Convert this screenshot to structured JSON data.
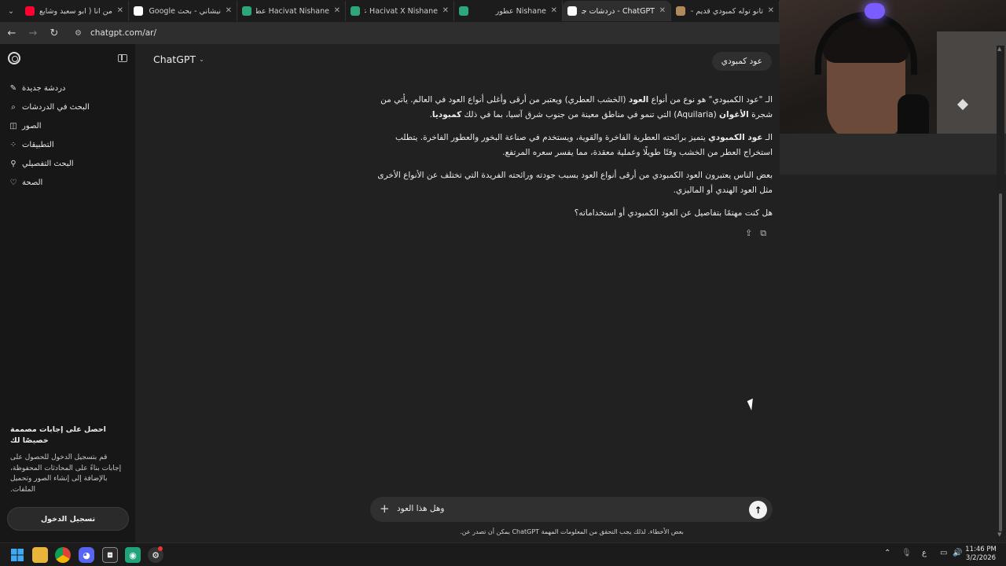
{
  "browser": {
    "tabs": [
      {
        "title": "من انا ( ابو سعيد وشايع ضـ",
        "favicon": "youtube-icon",
        "color": "#ff0033",
        "active": false
      },
      {
        "title": "نيشاني - بحث Google",
        "favicon": "google-icon",
        "color": "#ffffff",
        "active": false
      },
      {
        "title": "Hacivat Nishane عطر - a f",
        "favicon": "fragrantica-icon",
        "color": "#2fa67a",
        "active": false
      },
      {
        "title": "Hacivat X Nishane عطر - a",
        "favicon": "fragrantica-icon",
        "color": "#2fa67a",
        "active": false
      },
      {
        "title": "Nishane عطور",
        "favicon": "fragrantica-icon",
        "color": "#2fa67a",
        "active": false
      },
      {
        "title": "ChatGPT - دردشات جي بي تي",
        "favicon": "chatgpt-icon",
        "color": "#ffffff",
        "active": true
      },
      {
        "title": "تانو توله كمبودي قديم - ــ",
        "favicon": "site-icon",
        "color": "#b08a5a",
        "active": false
      }
    ],
    "tab_close_glyph": "✕",
    "url": "chatgpt.com/ar/"
  },
  "sidebar": {
    "items": [
      {
        "label": "دردشة جديدة",
        "icon": "edit-icon",
        "glyph": "✎"
      },
      {
        "label": "البحث في الدردشات",
        "icon": "search-icon",
        "glyph": "⌕"
      },
      {
        "label": "الصور",
        "icon": "image-icon",
        "glyph": "◫"
      },
      {
        "label": "التطبيقات",
        "icon": "apps-icon",
        "glyph": "⁘"
      },
      {
        "label": "البحث التفصيلي",
        "icon": "research-icon",
        "glyph": "⚲"
      },
      {
        "label": "الصحة",
        "icon": "heart-icon",
        "glyph": "♡"
      }
    ],
    "promo_title": "احصل على إجابات مصممة خصيصًا لك",
    "promo_body": "قم بتسجيل الدخول للحصول على إجابات بناءً على المحادثات المحفوظة، بالإضافة إلى إنشاء الصور وتحميل الملفات.",
    "login_label": "تسجيل الدخول"
  },
  "header": {
    "model_label": "ChatGPT"
  },
  "conversation": {
    "user_message": "عود كمبودي",
    "answer": {
      "p1_a": "الـ \"عود الكمبودي\" هو نوع من أنواع ",
      "p1_b": "العود",
      "p1_c": " (الخشب العطري) ويعتبر من أرقى وأغلى أنواع العود في العالم. يأتي من شجرة ",
      "p1_d": "الأغوان",
      "p1_e": " (Aquilaria) التي تنمو في مناطق معينة من جنوب شرق آسيا، بما في ذلك ",
      "p1_f": "كمبوديا",
      "p1_g": ".",
      "p2_a": "الـ ",
      "p2_b": "عود الكمبودي",
      "p2_c": " يتميز برائحته العطرية الفاخرة والقوية، ويستخدم في صناعة البخور والعطور الفاخرة. يتطلب استخراج العطر من الخشب وقتًا طويلًا وعملية معقدة، مما يفسر سعره المرتفع.",
      "p3": "بعض الناس يعتبرون العود الكمبودي من أرقى أنواع العود بسبب جودته ورائحته الفريدة التي تختلف عن الأنواع الأخرى مثل العود الهندي أو الماليزي.",
      "p4": "هل كنت مهتمًا بتفاصيل عن العود الكمبودي أو استخداماته؟"
    }
  },
  "composer": {
    "value": "وهل هذا العود",
    "disclaimer": "بعض الأخطاء. لذلك يجب التحقق من المعلومات المهمة ChatGPT يمكن أن تصدر عن."
  },
  "taskbar": {
    "input_lang": "ع",
    "time": "11:46 PM",
    "date": "3/2/2026"
  }
}
